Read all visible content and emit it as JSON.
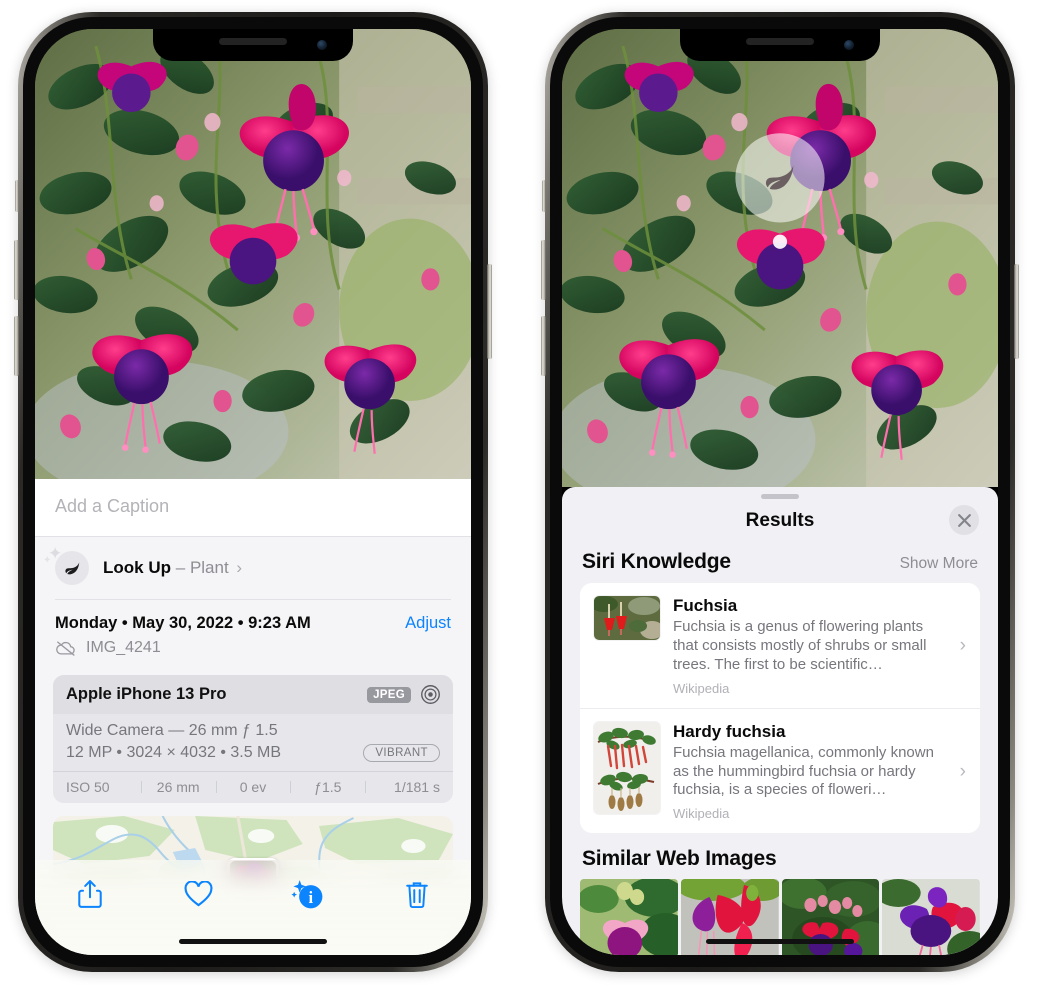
{
  "left_phone": {
    "photo_alt": "fuchsia-flowers-photo",
    "caption_placeholder": "Add a Caption",
    "lookup": {
      "icon": "leaf-icon",
      "label": "Look Up",
      "dash": "–",
      "subject": "Plant",
      "chevron": "›"
    },
    "date": "Monday • May 30, 2022 • 9:23 AM",
    "adjust_label": "Adjust",
    "file_icon": "icloud-slash-icon",
    "file_name": "IMG_4241",
    "camera": {
      "model": "Apple iPhone 13 Pro",
      "format_chip": "JPEG",
      "aperture_icon": "aperture-icon",
      "lens_line": "Wide Camera — 26 mm ƒ 1.5",
      "size_line": "12 MP • 3024 × 4032 • 3.5 MB",
      "style_chip": "VIBRANT",
      "exif": [
        "ISO 50",
        "26 mm",
        "0 ev",
        "ƒ1.5",
        "1/181 s"
      ]
    },
    "map_alt": "photo-location-map",
    "toolbar": [
      {
        "name": "share-button",
        "icon": "share-icon"
      },
      {
        "name": "favorite-button",
        "icon": "heart-icon"
      },
      {
        "name": "info-button",
        "icon": "info-sparkle-icon"
      },
      {
        "name": "delete-button",
        "icon": "trash-icon"
      }
    ]
  },
  "right_phone": {
    "photo_alt": "fuchsia-flowers-photo",
    "lookup_badge_icon": "leaf-icon",
    "sheet": {
      "title": "Results",
      "close_icon": "close-icon",
      "siri_section": {
        "title": "Siri Knowledge",
        "show_more": "Show More",
        "items": [
          {
            "title": "Fuchsia",
            "description": "Fuchsia is a genus of flowering plants that consists mostly of shrubs or small trees. The first to be scientific…",
            "source": "Wikipedia",
            "thumb": "red-fuchsia-thumb"
          },
          {
            "title": "Hardy fuchsia",
            "description": "Fuchsia magellanica, commonly known as the hummingbird fuchsia or hardy fuchsia, is a species of floweri…",
            "source": "Wikipedia",
            "thumb": "hardy-fuchsia-specimen-thumb"
          }
        ]
      },
      "web_section": {
        "title": "Similar Web Images",
        "images": [
          "fuchsia-web-image-1",
          "fuchsia-web-image-2",
          "fuchsia-web-image-3",
          "fuchsia-web-image-4"
        ]
      }
    }
  },
  "colors": {
    "accent_blue": "#0b84fe",
    "sheet_bg": "#f1f1f5",
    "card_bg": "#ffffff",
    "muted_text": "#8d8d93"
  }
}
